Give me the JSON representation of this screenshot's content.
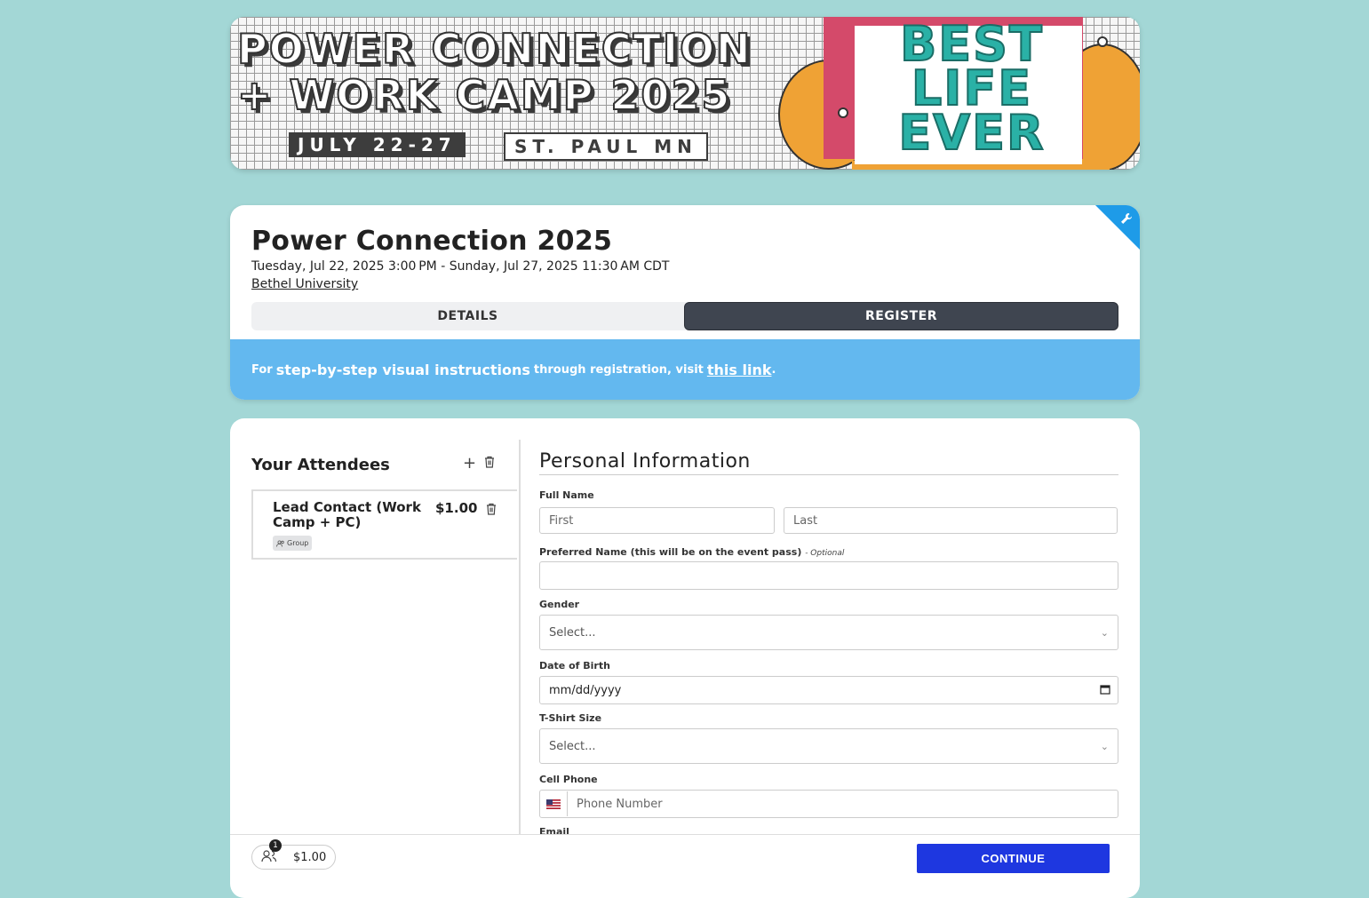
{
  "banner": {
    "title_line1": "POWER CONNECTION",
    "title_line2": "+ WORK CAMP 2025",
    "dates": "JULY 22-27",
    "place": "ST. PAUL MN",
    "graphic_text": "BEST LIFE EVER"
  },
  "event": {
    "title": "Power Connection 2025",
    "dates": "Tuesday, Jul 22, 2025 3:00 PM - Sunday, Jul 27, 2025 11:30 AM CDT",
    "venue": "Bethel University",
    "tabs": [
      {
        "label": "DETAILS",
        "active": false
      },
      {
        "label": "REGISTER",
        "active": true
      }
    ],
    "info": {
      "prefix": "For",
      "emphasis": "step-by-step visual instructions",
      "middle": "through registration, visit",
      "link": "this link",
      "suffix": "."
    }
  },
  "attendees": {
    "heading": "Your Attendees",
    "add_icon": "plus-icon",
    "delete_icon": "trash-icon",
    "items": [
      {
        "name": "Lead Contact (Work Camp + PC)",
        "price": "$1.00",
        "badge": "Group"
      }
    ]
  },
  "form": {
    "heading": "Personal Information",
    "full_name": {
      "label": "Full Name",
      "first_placeholder": "First",
      "last_placeholder": "Last"
    },
    "preferred_name": {
      "label": "Preferred Name (this will be on the event pass)",
      "optional": "- Optional"
    },
    "gender": {
      "label": "Gender",
      "value": "Select..."
    },
    "dob": {
      "label": "Date of Birth",
      "value": "mm/dd/yyyy"
    },
    "tshirt": {
      "label": "T-Shirt Size",
      "value": "Select..."
    },
    "cell": {
      "label": "Cell Phone",
      "placeholder": "Phone Number"
    },
    "email": {
      "label": "Email"
    }
  },
  "footer": {
    "count": "1",
    "total": "$1.00",
    "continue_label": "CONTINUE"
  },
  "colors": {
    "background": "#a3d7d6",
    "info_strip": "#63b8ef",
    "active_tab": "#3f4550",
    "continue": "#1e37e0",
    "corner_flag": "#1e9be8"
  }
}
